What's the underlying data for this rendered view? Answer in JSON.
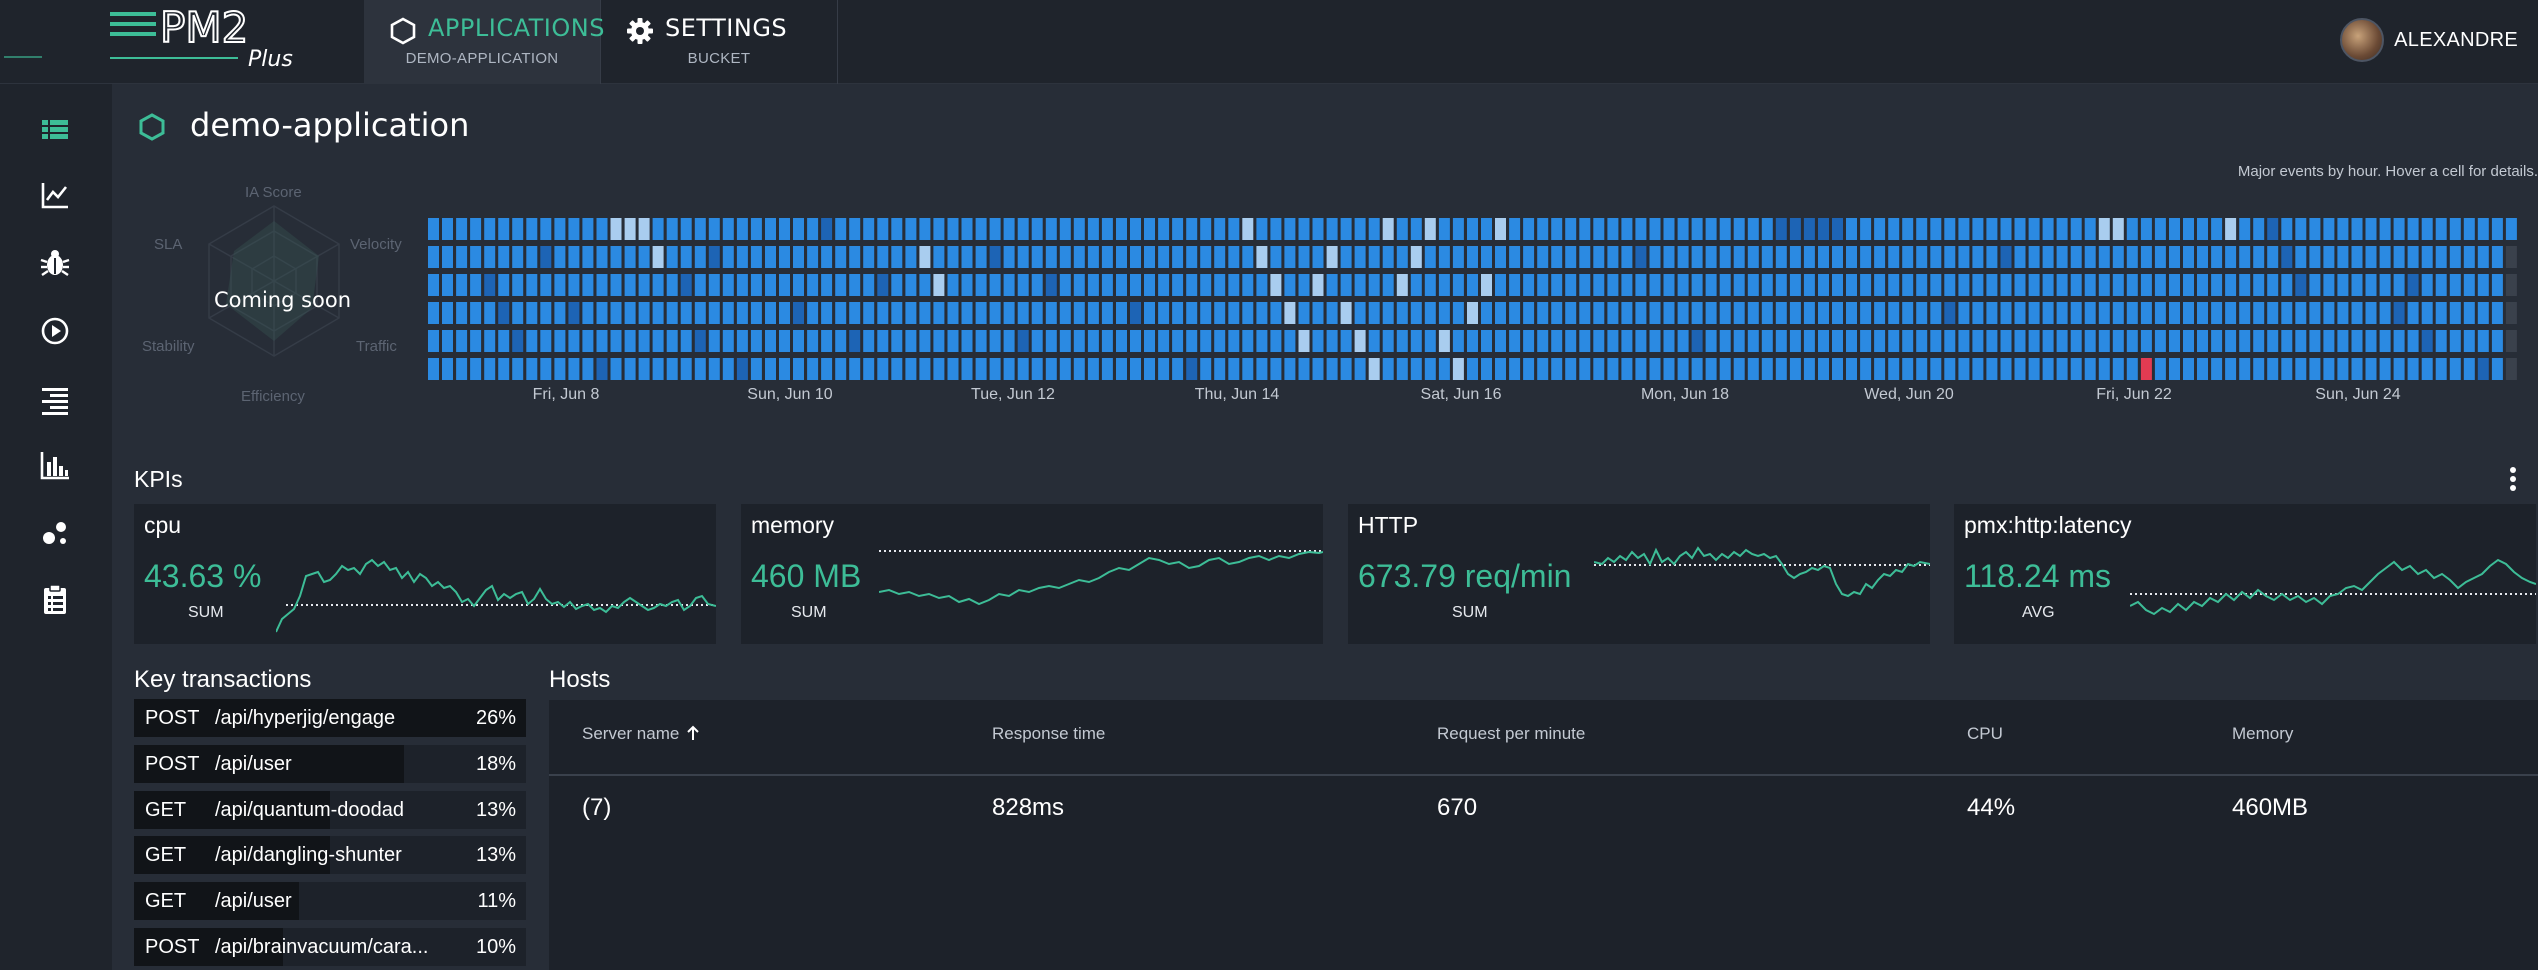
{
  "brand": {
    "logo_text": "PM2",
    "logo_sub": "Plus",
    "accent": "#3dbd97"
  },
  "tabs": [
    {
      "label": "APPLICATIONS",
      "sub": "DEMO-APPLICATION",
      "icon": "hexagon-icon",
      "active": true
    },
    {
      "label": "SETTINGS",
      "sub": "BUCKET",
      "icon": "gear-icon",
      "active": false
    }
  ],
  "user": {
    "name": "ALEXANDRE"
  },
  "sidebar": {
    "items": [
      {
        "icon": "list-icon",
        "active": true
      },
      {
        "icon": "line-chart-icon",
        "active": false
      },
      {
        "icon": "bug-icon",
        "active": false
      },
      {
        "icon": "play-circle-icon",
        "active": false
      },
      {
        "icon": "align-right-icon",
        "active": false
      },
      {
        "icon": "bar-chart-icon",
        "active": false
      },
      {
        "icon": "bubbles-icon",
        "active": false
      },
      {
        "icon": "clipboard-icon",
        "active": false
      }
    ]
  },
  "page": {
    "title": "demo-application",
    "heatmap_hint": "Major events by hour. Hover a cell for details."
  },
  "radar": {
    "labels": {
      "ia": "IA Score",
      "velocity": "Velocity",
      "traffic": "Traffic",
      "efficiency": "Efficiency",
      "stability": "Stability",
      "sla": "SLA"
    },
    "message": "Coming soon"
  },
  "heatmap": {
    "day_labels": [
      "Fri, Jun 8",
      "Sun, Jun 10",
      "Tue, Jun 12",
      "Thu, Jun 14",
      "Sat, Jun 16",
      "Mon, Jun 18",
      "Wed, Jun 20",
      "Fri, Jun 22",
      "Sun, Jun 24"
    ],
    "colors": {
      "normal": "#2b8ae2",
      "dark": "#1d64b5",
      "light": "#a9cdef",
      "alert": "#e23b52",
      "empty": "#3a414c"
    }
  },
  "kpis": {
    "title": "KPIs",
    "cards": [
      {
        "name": "cpu",
        "value": "43.63 %",
        "agg": "SUM"
      },
      {
        "name": "memory",
        "value": "460 MB",
        "agg": "SUM"
      },
      {
        "name": "HTTP",
        "value": "673.79 req/min",
        "agg": "SUM"
      },
      {
        "name": "pmx:http:latency",
        "value": "118.24 ms",
        "agg": "AVG"
      }
    ]
  },
  "transactions": {
    "title": "Key transactions",
    "rows": [
      {
        "method": "POST",
        "path": "/api/hyperjig/engage",
        "pct": "26%",
        "share": 1.0
      },
      {
        "method": "POST",
        "path": "/api/user",
        "pct": "18%",
        "share": 0.69
      },
      {
        "method": "GET",
        "path": "/api/quantum-doodad",
        "pct": "13%",
        "share": 0.5
      },
      {
        "method": "GET",
        "path": "/api/dangling-shunter",
        "pct": "13%",
        "share": 0.5
      },
      {
        "method": "GET",
        "path": "/api/user",
        "pct": "11%",
        "share": 0.42
      },
      {
        "method": "POST",
        "path": "/api/brainvacuum/cara...",
        "pct": "10%",
        "share": 0.38
      }
    ]
  },
  "hosts": {
    "title": "Hosts",
    "columns": [
      "Server name",
      "Response time",
      "Request per minute",
      "CPU",
      "Memory"
    ],
    "row": {
      "server": "(7)",
      "response": "828ms",
      "rpm": "670",
      "cpu": "44%",
      "memory": "460MB"
    }
  }
}
